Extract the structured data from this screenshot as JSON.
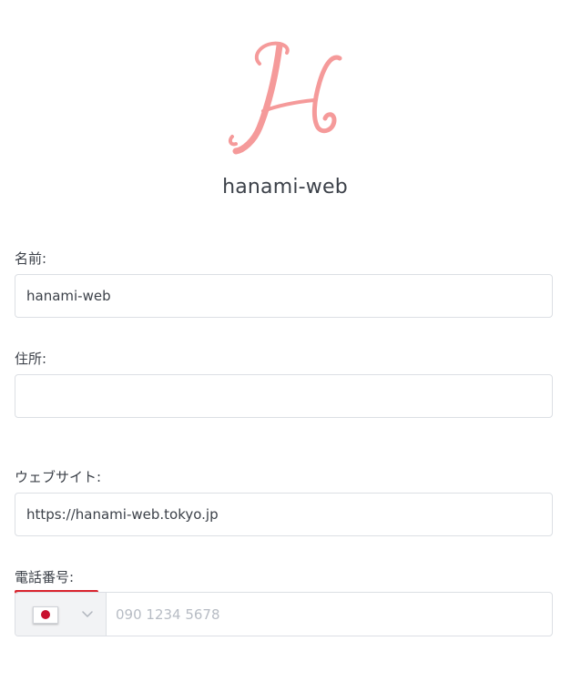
{
  "brand": {
    "site_name": "hanami-web",
    "logo_icon": "hanami-h-monogram-icon",
    "logo_color": "#f59a9a"
  },
  "form": {
    "name_label": "名前:",
    "name_value": "hanami-web",
    "address_label": "住所:",
    "address_value": "",
    "website_label": "ウェブサイト:",
    "website_value": "https://hanami-web.tokyo.jp",
    "phone_label": "電話番号:",
    "phone_country_icon": "japan-flag-icon",
    "phone_placeholder": "090 1234 5678"
  },
  "colors": {
    "label_text": "#3c4149",
    "border": "#dcdfe4",
    "highlight_underline": "#d9232d",
    "placeholder": "#b7bcc4"
  }
}
